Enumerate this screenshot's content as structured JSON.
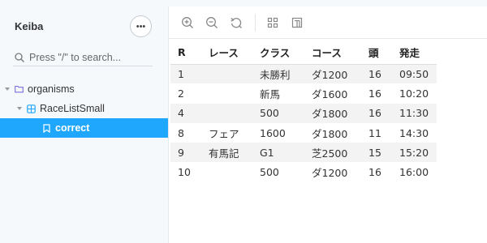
{
  "app": {
    "title": "Keiba"
  },
  "sidebar": {
    "menu_label": "•••",
    "search": {
      "placeholder": "Press \"/\" to search..."
    },
    "tree": [
      {
        "label": "organisms",
        "type": "folder"
      },
      {
        "label": "RaceListSmall",
        "type": "component"
      },
      {
        "label": "correct",
        "type": "story",
        "selected": true
      }
    ]
  },
  "toolbar": {
    "icons": [
      "zoom-in-icon",
      "zoom-out-icon",
      "reset-zoom-icon",
      "grid-icon",
      "background-icon"
    ]
  },
  "table": {
    "headers": [
      "R",
      "レース",
      "クラス",
      "コース",
      "頭",
      "発走"
    ],
    "rows": [
      [
        "1",
        "",
        "未勝利",
        "ダ1200",
        "16",
        "09:50"
      ],
      [
        "2",
        "",
        "新馬",
        "ダ1600",
        "16",
        "10:20"
      ],
      [
        "4",
        "",
        "500",
        "ダ1800",
        "16",
        "11:30"
      ],
      [
        "8",
        "フェア",
        "1600",
        "ダ1800",
        "11",
        "14:30"
      ],
      [
        "9",
        "有馬記",
        "G1",
        "芝2500",
        "15",
        "15:20"
      ],
      [
        "10",
        "",
        "500",
        "ダ1200",
        "16",
        "16:00"
      ]
    ]
  },
  "colors": {
    "accent": "#1ea7fd",
    "sidebar_bg": "#f6f9fc",
    "stripe": "#f3f3f3"
  }
}
